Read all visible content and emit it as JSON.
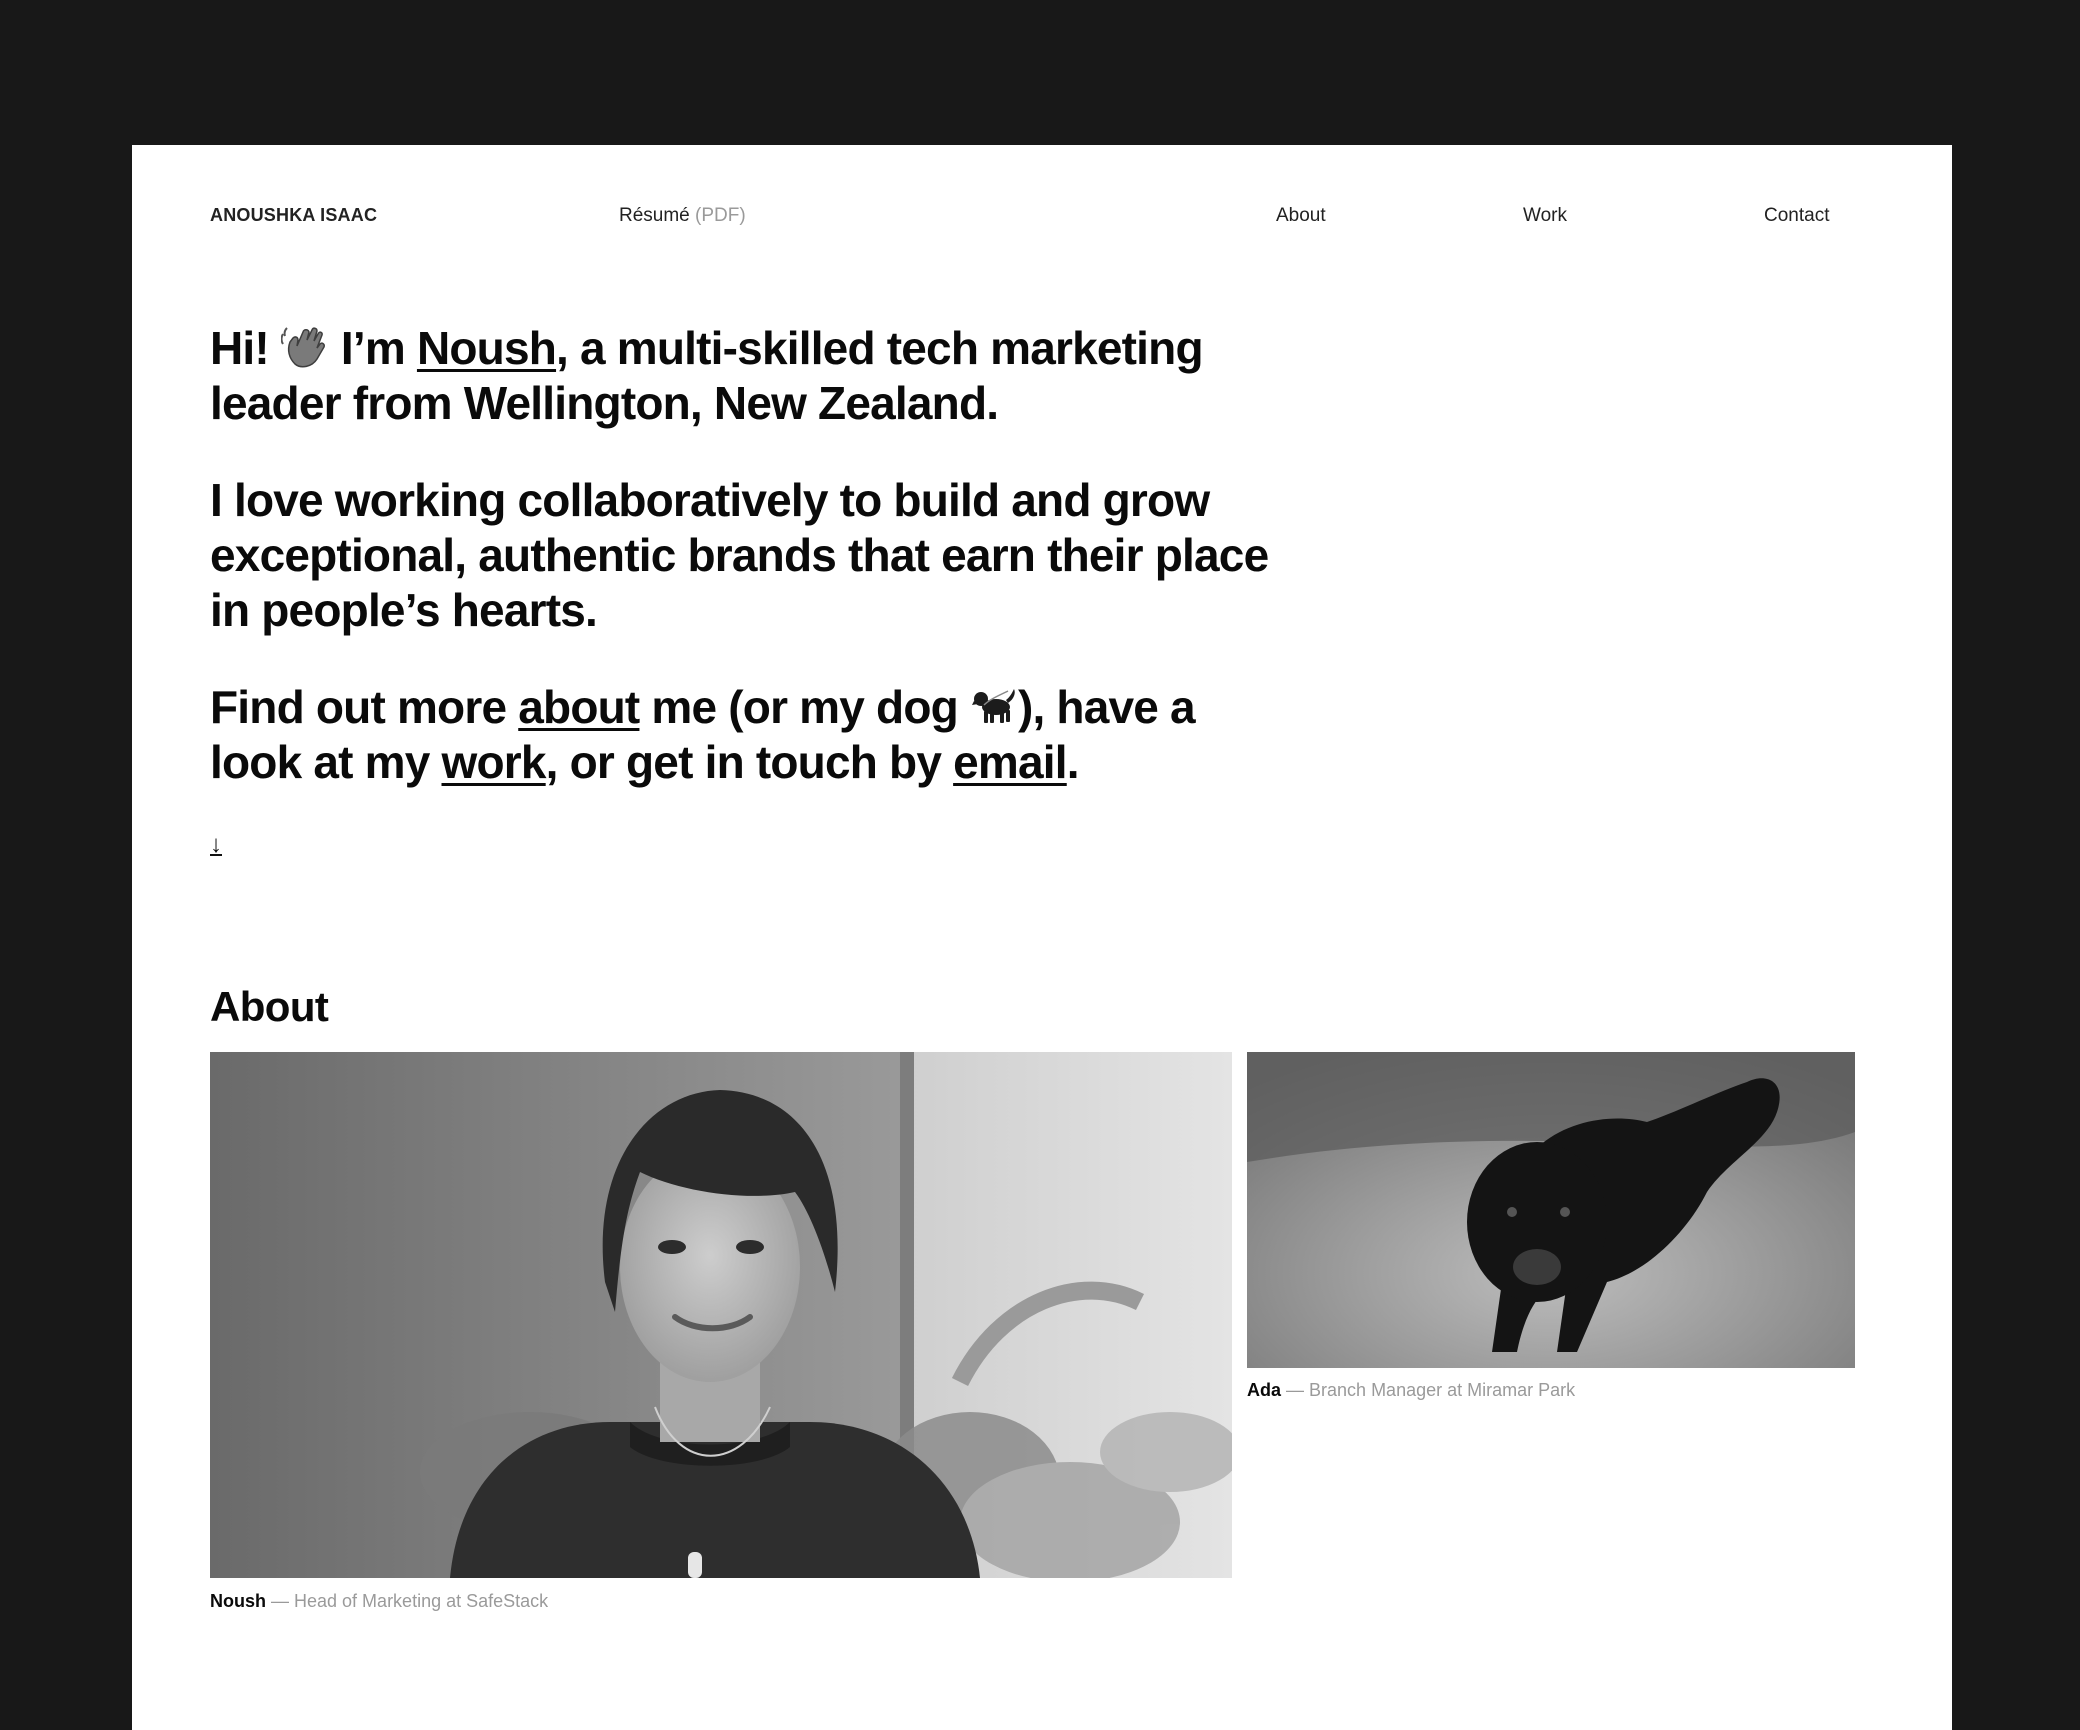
{
  "nav": {
    "brand": "ANOUSHKA ISAAC",
    "resume_label": "Résumé",
    "resume_suffix": "(PDF)",
    "links": [
      {
        "label": "About"
      },
      {
        "label": "Work"
      },
      {
        "label": "Contact"
      }
    ]
  },
  "hero": {
    "p1_hi": "Hi!",
    "p1_im": "I’m",
    "p1_name": "Noush",
    "p1_rest": ", a multi-skilled tech marketing leader from Wellington, New Zealand.",
    "p2": "I love working collaboratively to build and grow exceptional, authentic brands that earn their place in people’s hearts.",
    "p3_start": "Find out more",
    "p3_about": "about",
    "p3_mid1": "me (or my dog",
    "p3_mid2": "), have a look at my",
    "p3_work": "work",
    "p3_mid3": ", or get in touch by",
    "p3_email": "email",
    "p3_end": ".",
    "wave_icon": "waving-hand-icon",
    "dog_icon": "dog-icon",
    "scroll_arrow": "↓"
  },
  "about": {
    "title": "About",
    "noush_caption_name": "Noush",
    "noush_caption_role": "— Head of Marketing at SafeStack",
    "ada_caption_name": "Ada",
    "ada_caption_role": "— Branch Manager at Miramar Park"
  },
  "colors": {
    "frame": "#181818",
    "page": "#ffffff",
    "text": "#0a0a0a",
    "muted": "#9a9a9a"
  }
}
